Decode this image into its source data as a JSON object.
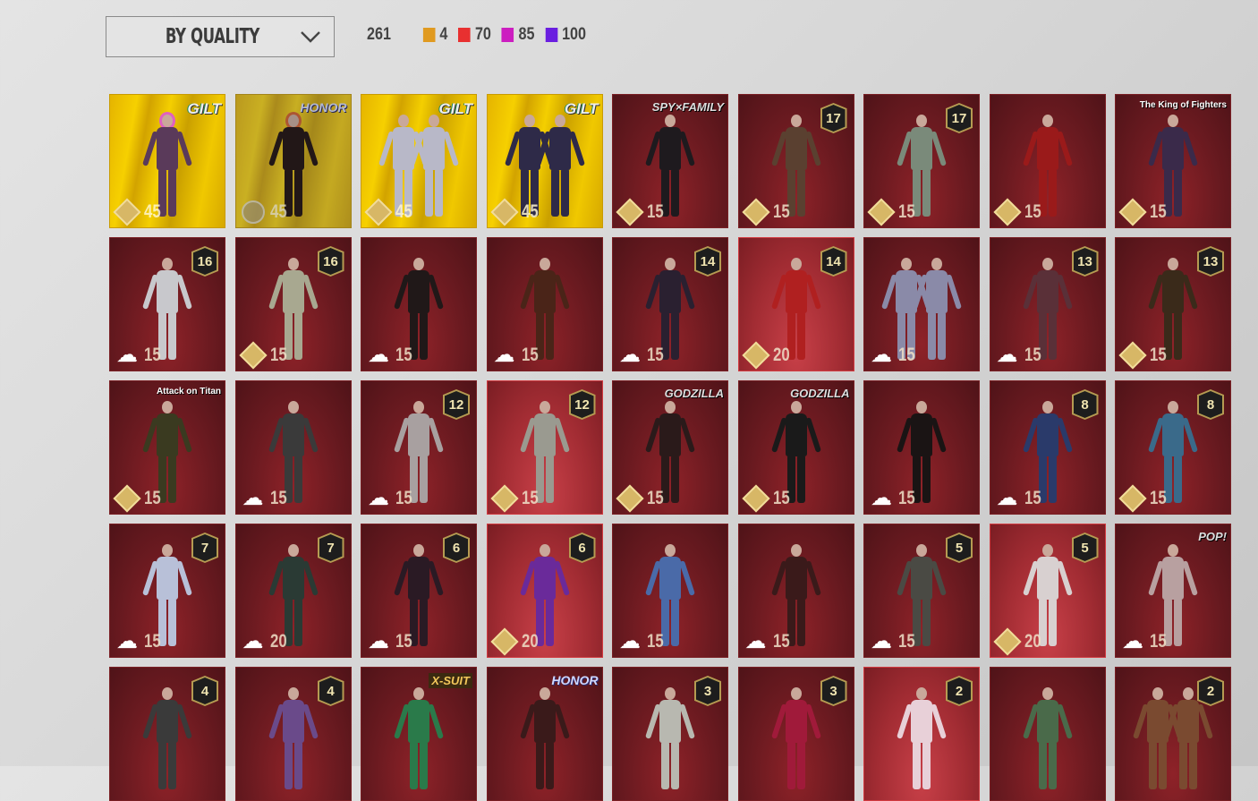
{
  "sort_dropdown": {
    "label": "BY QUALITY"
  },
  "stats": {
    "total": "261",
    "tiers": [
      {
        "color": "#e09a20",
        "count": "4"
      },
      {
        "color": "#e83030",
        "count": "70"
      },
      {
        "color": "#cc1ec0",
        "count": "85"
      },
      {
        "color": "#6a1ee0",
        "count": "100"
      }
    ]
  },
  "items": [
    {
      "tier": "gold",
      "brand": "GILT",
      "brand_style": "gilt",
      "currency": "diamond",
      "price": "45",
      "fig": "#5a3a5a",
      "hair": "#e060c0"
    },
    {
      "tier": "gold",
      "dim": true,
      "brand": "HONOR",
      "brand_style": "honor",
      "currency": "circle",
      "price": "45",
      "fig": "#2a1a1a",
      "hair": "#e0602a"
    },
    {
      "tier": "gold",
      "brand": "GILT",
      "brand_style": "gilt",
      "currency": "diamond",
      "price": "45",
      "fig": "#b8b8c8",
      "two": true
    },
    {
      "tier": "gold",
      "brand": "GILT",
      "brand_style": "gilt",
      "currency": "diamond",
      "price": "45",
      "fig": "#2e2a48",
      "two": true
    },
    {
      "tier": "red",
      "brand": "SPY×FAMILY",
      "brand_style": "god",
      "currency": "diamond",
      "price": "15",
      "fig": "#1e1a1e"
    },
    {
      "tier": "red",
      "badge": "17",
      "currency": "diamond",
      "price": "15",
      "fig": "#5a4030"
    },
    {
      "tier": "red",
      "badge": "17",
      "currency": "diamond",
      "price": "15",
      "fig": "#7a8a7a"
    },
    {
      "tier": "red",
      "currency": "diamond",
      "price": "15",
      "fig": "#9a1a1a"
    },
    {
      "tier": "red",
      "brand": "The King of Fighters",
      "brand_style": "small",
      "currency": "diamond",
      "price": "15",
      "fig": "#3a2a4a"
    },
    {
      "tier": "red",
      "badge": "16",
      "currency": "cloud",
      "price": "15",
      "fig": "#c8c8cc"
    },
    {
      "tier": "red",
      "badge": "16",
      "currency": "diamond",
      "price": "15",
      "fig": "#a8a890"
    },
    {
      "tier": "red",
      "currency": "cloud",
      "price": "15",
      "fig": "#201818"
    },
    {
      "tier": "red",
      "currency": "cloud",
      "price": "15",
      "fig": "#4a2418"
    },
    {
      "tier": "red",
      "badge": "14",
      "currency": "cloud",
      "price": "15",
      "fig": "#2a2030"
    },
    {
      "tier": "red",
      "hl": true,
      "badge": "14",
      "currency": "diamond",
      "price": "20",
      "fig": "#b02020"
    },
    {
      "tier": "red",
      "currency": "cloud",
      "price": "15",
      "fig": "#8a8aa8",
      "two": true
    },
    {
      "tier": "red",
      "badge": "13",
      "currency": "cloud",
      "price": "15",
      "fig": "#5a3038"
    },
    {
      "tier": "red",
      "badge": "13",
      "currency": "diamond",
      "price": "15",
      "fig": "#3a2a1a"
    },
    {
      "tier": "red",
      "brand": "Attack on Titan",
      "brand_style": "small",
      "currency": "diamond",
      "price": "15",
      "fig": "#3a3a20"
    },
    {
      "tier": "red",
      "currency": "cloud",
      "price": "15",
      "fig": "#3a3a3a"
    },
    {
      "tier": "red",
      "badge": "12",
      "currency": "cloud",
      "price": "15",
      "fig": "#a8a0a0"
    },
    {
      "tier": "red",
      "hl": true,
      "badge": "12",
      "currency": "diamond",
      "price": "15",
      "fig": "#9a9a90"
    },
    {
      "tier": "red",
      "brand": "GODZILLA",
      "brand_style": "god",
      "currency": "diamond",
      "price": "15",
      "fig": "#2a1a1a"
    },
    {
      "tier": "red",
      "brand": "GODZILLA",
      "brand_style": "god",
      "currency": "diamond",
      "price": "15",
      "fig": "#1a1a1a"
    },
    {
      "tier": "red",
      "currency": "cloud",
      "price": "15",
      "fig": "#1a1414"
    },
    {
      "tier": "red",
      "badge": "8",
      "currency": "cloud",
      "price": "15",
      "fig": "#2a3a6a"
    },
    {
      "tier": "red",
      "badge": "8",
      "currency": "diamond",
      "price": "15",
      "fig": "#3a6a8a"
    },
    {
      "tier": "red",
      "badge": "7",
      "currency": "cloud",
      "price": "15",
      "fig": "#b8c0d8"
    },
    {
      "tier": "red",
      "badge": "7",
      "currency": "cloud",
      "price": "20",
      "fig": "#2a3a34"
    },
    {
      "tier": "red",
      "badge": "6",
      "currency": "cloud",
      "price": "15",
      "fig": "#2a1a24"
    },
    {
      "tier": "red",
      "hl": true,
      "badge": "6",
      "currency": "diamond",
      "price": "20",
      "fig": "#6a2a9a"
    },
    {
      "tier": "red",
      "currency": "cloud",
      "price": "15",
      "fig": "#4a6aa8"
    },
    {
      "tier": "red",
      "currency": "cloud",
      "price": "15",
      "fig": "#3a1a1a"
    },
    {
      "tier": "red",
      "badge": "5",
      "currency": "cloud",
      "price": "15",
      "fig": "#4a4a44"
    },
    {
      "tier": "red",
      "hl": true,
      "badge": "5",
      "currency": "diamond",
      "price": "20",
      "fig": "#d8d0d0"
    },
    {
      "tier": "red",
      "brand": "POP!",
      "brand_style": "god",
      "currency": "cloud",
      "price": "15",
      "fig": "#b8a0a0"
    },
    {
      "tier": "red",
      "badge": "4",
      "fig": "#3a3a3a"
    },
    {
      "tier": "red",
      "badge": "4",
      "fig": "#6a4a8a"
    },
    {
      "tier": "red",
      "brand": "X-SUIT",
      "brand_style": "xsuit",
      "fig": "#2a7a4a"
    },
    {
      "tier": "red",
      "brand": "HONOR",
      "brand_style": "honor",
      "fig": "#3a1a1a"
    },
    {
      "tier": "red",
      "badge": "3",
      "fig": "#b8b8b0"
    },
    {
      "tier": "red",
      "badge": "3",
      "fig": "#a01a3a"
    },
    {
      "tier": "red",
      "hl": true,
      "badge": "2",
      "fig": "#e8d0d8"
    },
    {
      "tier": "red",
      "fig": "#4a6a4a"
    },
    {
      "tier": "red",
      "badge": "2",
      "fig": "#7a4a30",
      "two": true
    }
  ]
}
